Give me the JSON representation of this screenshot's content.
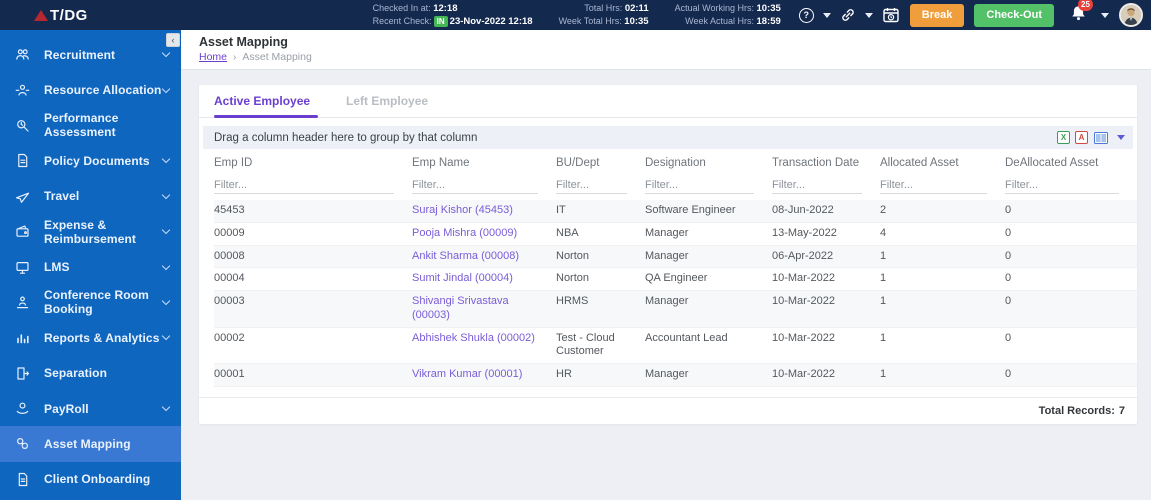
{
  "topbar": {
    "brand": "T/DG",
    "stats": {
      "checked_in_label": "Checked In at:",
      "checked_in_value": "12:18",
      "recent_check_label": "Recent Check:",
      "recent_check_badge": "IN",
      "recent_check_value": "23-Nov-2022 12:18",
      "total_hrs_label": "Total Hrs:",
      "total_hrs_value": "02:11",
      "week_total_hrs_label": "Week Total Hrs:",
      "week_total_hrs_value": "10:35",
      "actual_working_hrs_label": "Actual Working Hrs:",
      "actual_working_hrs_value": "10:35",
      "week_actual_hrs_label": "Week Actual Hrs:",
      "week_actual_hrs_value": "18:59"
    },
    "break_button": "Break",
    "checkout_button": "Check-Out",
    "notification_count": "25",
    "help_glyph": "?"
  },
  "sidebar": {
    "items": [
      "Recruitment",
      "Resource Allocation",
      "Performance Assessment",
      "Policy Documents",
      "Travel",
      "Expense & Reimbursement",
      "LMS",
      "Conference Room Booking",
      "Reports & Analytics",
      "Separation",
      "PayRoll",
      "Asset Mapping",
      "Client Onboarding"
    ],
    "active_item": "Asset Mapping"
  },
  "page": {
    "title": "Asset Mapping",
    "breadcrumb_home": "Home",
    "breadcrumb_separator": "›",
    "breadcrumb_current": "Asset Mapping",
    "collapse_glyph": "‹"
  },
  "tabs": [
    "Active Employee",
    "Left Employee"
  ],
  "grid": {
    "group_panel_text": "Drag a column header here to group by that column",
    "filter_placeholder": "Filter...",
    "columns": [
      "Emp ID",
      "Emp Name",
      "BU/Dept",
      "Designation",
      "Transaction Date",
      "Allocated Asset",
      "DeAllocated Asset"
    ],
    "rows": [
      {
        "emp_id": "45453",
        "emp_name": "Suraj Kishor (45453)",
        "bu_dept": "IT",
        "designation": "Software Engineer",
        "transaction_date": "08-Jun-2022",
        "allocated": "2",
        "deallocated": "0"
      },
      {
        "emp_id": "00009",
        "emp_name": "Pooja Mishra (00009)",
        "bu_dept": "NBA",
        "designation": "Manager",
        "transaction_date": "13-May-2022",
        "allocated": "4",
        "deallocated": "0"
      },
      {
        "emp_id": "00008",
        "emp_name": "Ankit Sharma (00008)",
        "bu_dept": "Norton",
        "designation": "Manager",
        "transaction_date": "06-Apr-2022",
        "allocated": "1",
        "deallocated": "0"
      },
      {
        "emp_id": "00004",
        "emp_name": "Sumit Jindal (00004)",
        "bu_dept": "Norton",
        "designation": "QA Engineer",
        "transaction_date": "10-Mar-2022",
        "allocated": "1",
        "deallocated": "0"
      },
      {
        "emp_id": "00003",
        "emp_name": "Shivangi Srivastava (00003)",
        "bu_dept": "HRMS",
        "designation": "Manager",
        "transaction_date": "10-Mar-2022",
        "allocated": "1",
        "deallocated": "0"
      },
      {
        "emp_id": "00002",
        "emp_name": "Abhishek Shukla (00002)",
        "bu_dept": "Test - Cloud Customer",
        "designation": "Accountant Lead",
        "transaction_date": "10-Mar-2022",
        "allocated": "1",
        "deallocated": "0"
      },
      {
        "emp_id": "00001",
        "emp_name": "Vikram Kumar (00001)",
        "bu_dept": "HR",
        "designation": "Manager",
        "transaction_date": "10-Mar-2022",
        "allocated": "1",
        "deallocated": "0"
      }
    ],
    "footer_total_label": "Total Records:",
    "footer_total_value": "7"
  },
  "icons": {
    "export_excel_glyph": "X",
    "export_pdf_glyph": "A"
  },
  "colors": {
    "topbar_bg": "#14294e",
    "sidebar_bg": "#0f66bf",
    "sidebar_active_bg": "#3978d3",
    "accent_purple": "#6a3fd0",
    "link_purple": "#7a5cd8",
    "break_orange": "#f09e3c",
    "checkout_green": "#53c168",
    "notification_badge_red": "#e8403a",
    "in_badge_green": "#43b854",
    "page_bg": "#edeff4"
  }
}
